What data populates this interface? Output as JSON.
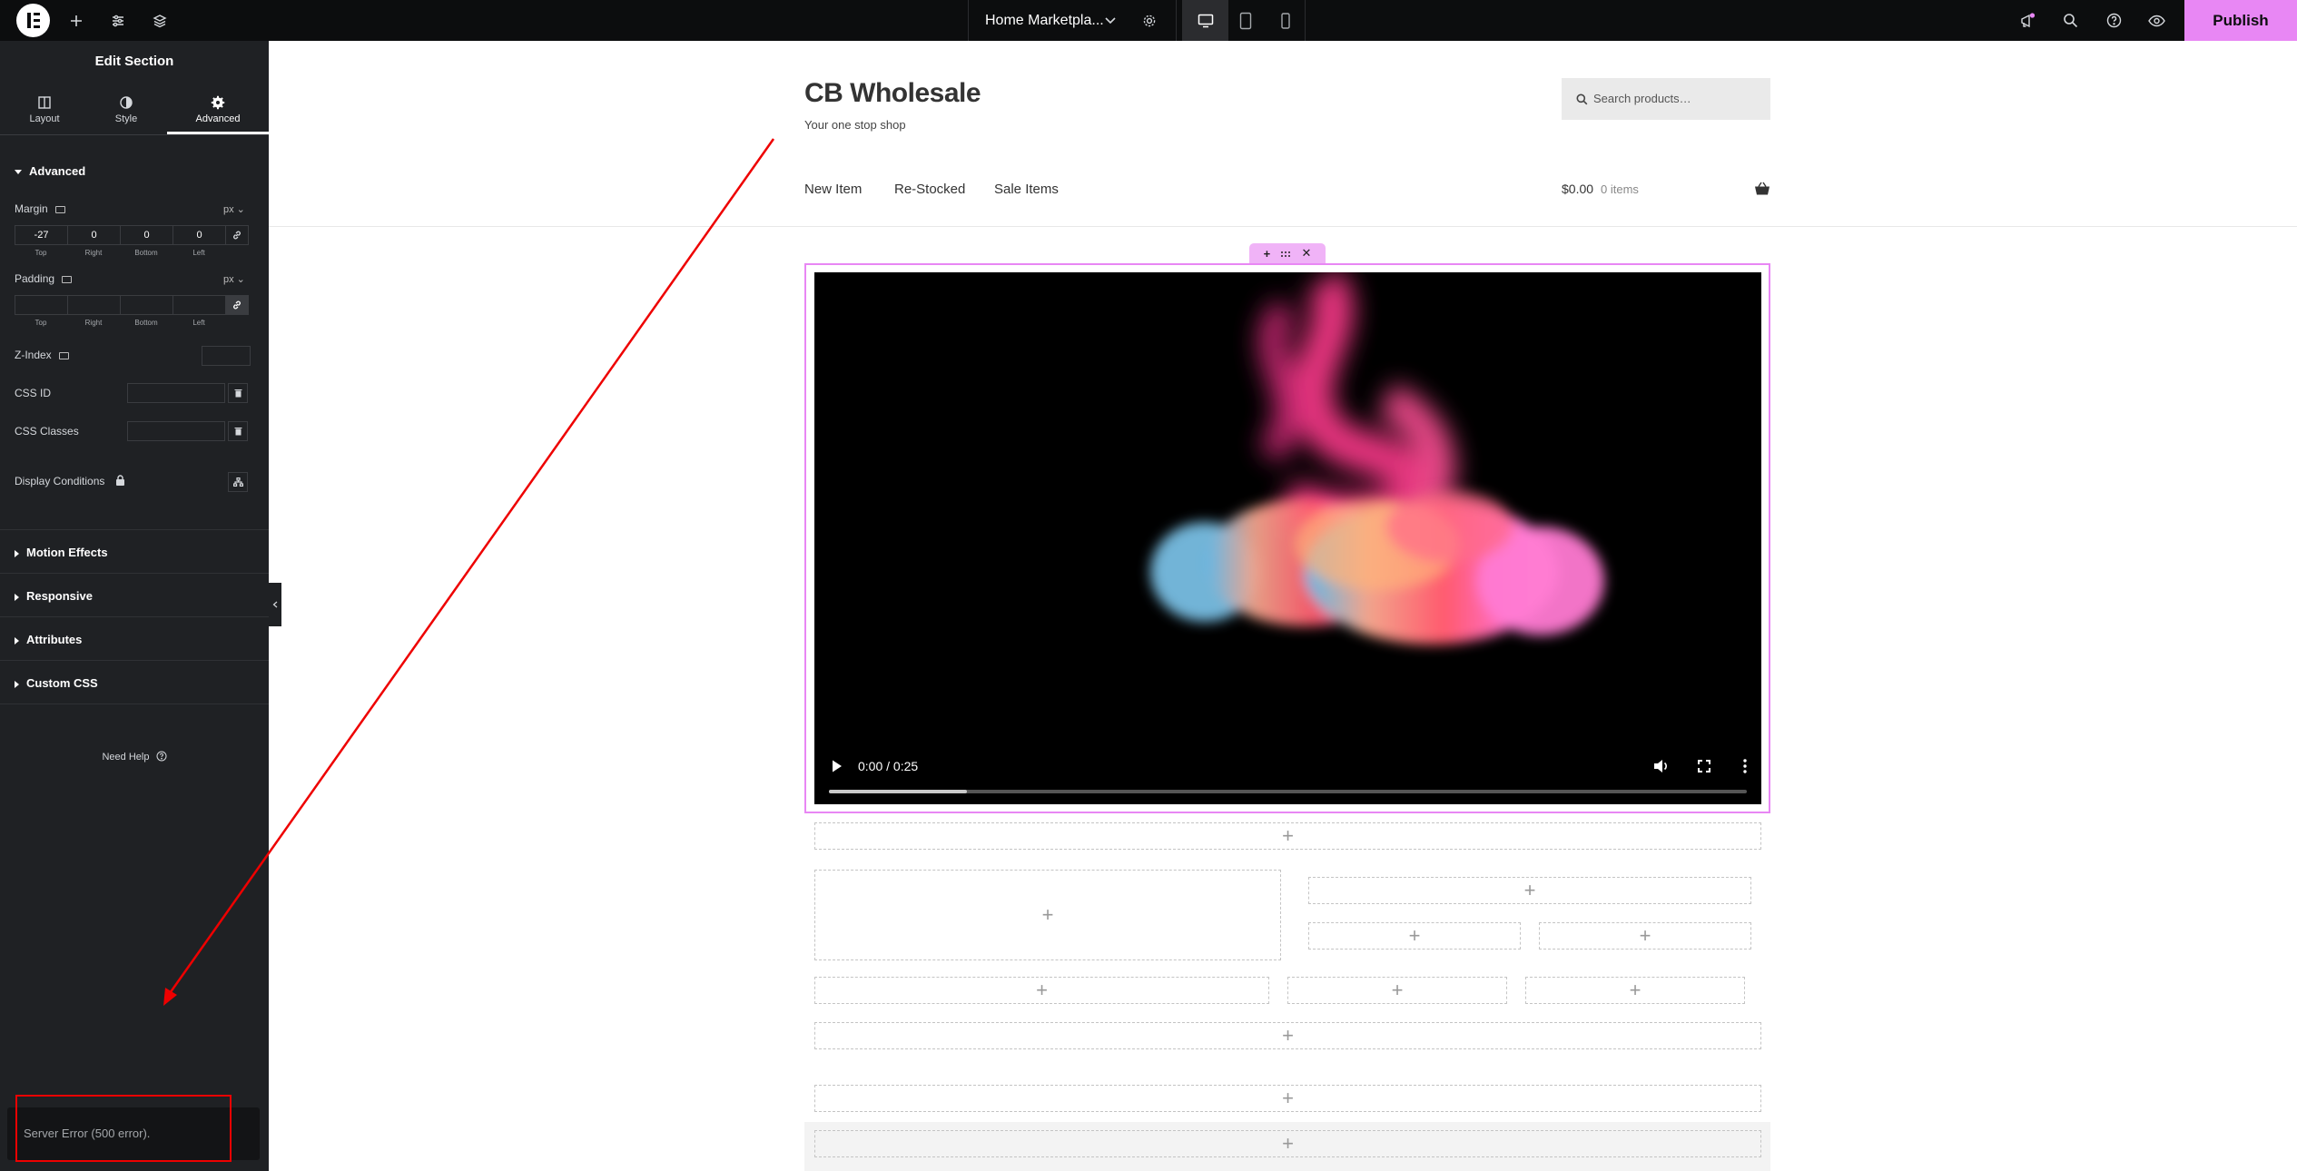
{
  "topbar": {
    "document_title": "Home Marketpla...",
    "publish_label": "Publish",
    "icons": [
      "elementor-logo-icon",
      "add-icon",
      "settings-sliders-icon",
      "layers-icon",
      "chevron-down-icon",
      "gear-icon",
      "desktop-icon",
      "tablet-icon",
      "mobile-icon",
      "notifications-icon",
      "search-icon",
      "help-icon",
      "preview-eye-icon"
    ]
  },
  "panel": {
    "title": "Edit Section",
    "tabs": [
      {
        "label": "Layout",
        "icon": "layout-icon"
      },
      {
        "label": "Style",
        "icon": "half-circle-icon"
      },
      {
        "label": "Advanced",
        "icon": "gear-icon"
      }
    ],
    "advanced_heading": "Advanced",
    "margin": {
      "label": "Margin",
      "unit": "px ⌄",
      "values": [
        "-27",
        "0",
        "0",
        "0"
      ],
      "sides": [
        "Top",
        "Right",
        "Bottom",
        "Left"
      ]
    },
    "padding": {
      "label": "Padding",
      "unit": "px ⌄",
      "values": [
        "",
        "",
        "",
        ""
      ],
      "sides": [
        "Top",
        "Right",
        "Bottom",
        "Left"
      ]
    },
    "z_index_label": "Z-Index",
    "css_id_label": "CSS ID",
    "css_classes_label": "CSS Classes",
    "display_conditions_label": "Display Conditions",
    "collapsed_sections": [
      "Motion Effects",
      "Responsive",
      "Attributes",
      "Custom CSS"
    ],
    "need_help": "Need Help",
    "error_message": "Server Error (500 error)."
  },
  "site": {
    "title": "CB Wholesale",
    "tagline": "Your one stop shop",
    "search_placeholder": "Search products…",
    "nav": [
      "New Item",
      "Re-Stocked",
      "Sale Items"
    ],
    "cart_total": "$0.00",
    "cart_items": "0 items"
  },
  "video": {
    "time": "0:00 / 0:25",
    "progress": 0.15
  },
  "colors": {
    "accent_pink": "#e887f4",
    "annotation_red": "#e00000",
    "panel_bg": "#1f2124",
    "topbar_bg": "#0c0d0e"
  }
}
